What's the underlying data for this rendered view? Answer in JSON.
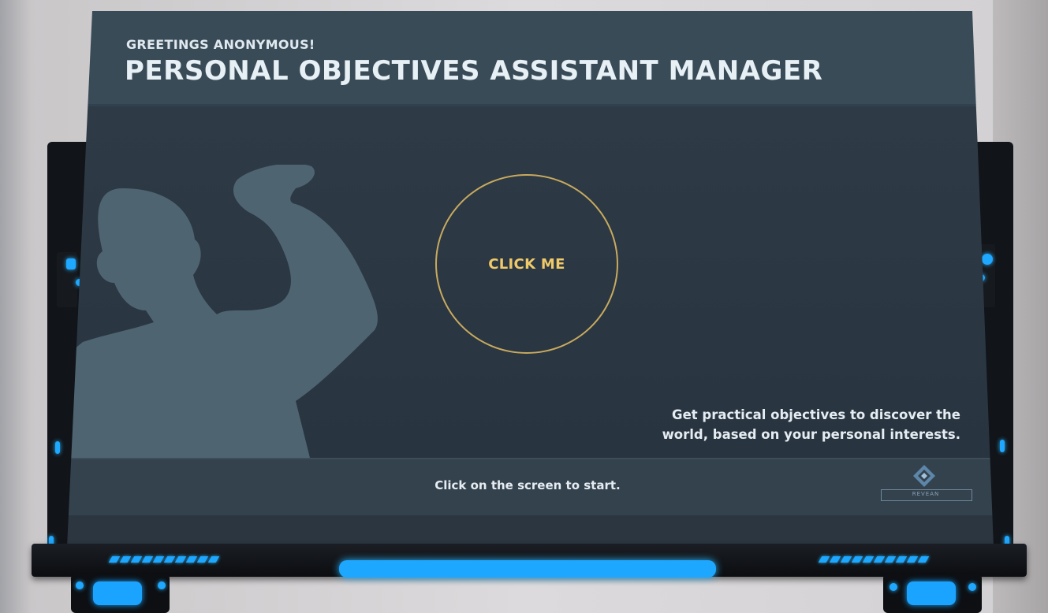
{
  "screen": {
    "greeting": "GREETINGS ANONYMOUS!",
    "title": "PERSONAL OBJECTIVES ASSISTANT MANAGER",
    "click_button_label": "CLICK ME",
    "tagline_line1": "Get practical objectives to discover the",
    "tagline_line2": "world, based on your personal interests.",
    "start_instruction": "Click on the screen to start.",
    "logo_icon": "diamond-logo-icon",
    "logo_text": "REVEAN"
  },
  "colors": {
    "screen_bg": "#2a3540",
    "header_bg": "#3a4b58",
    "accent_gold": "#f0c96a",
    "ring_gold": "#c9aa5e",
    "silhouette": "#4e6571",
    "frame_glow": "#1da7ff"
  },
  "icons": {
    "silhouette": "flexing-person-icon"
  }
}
